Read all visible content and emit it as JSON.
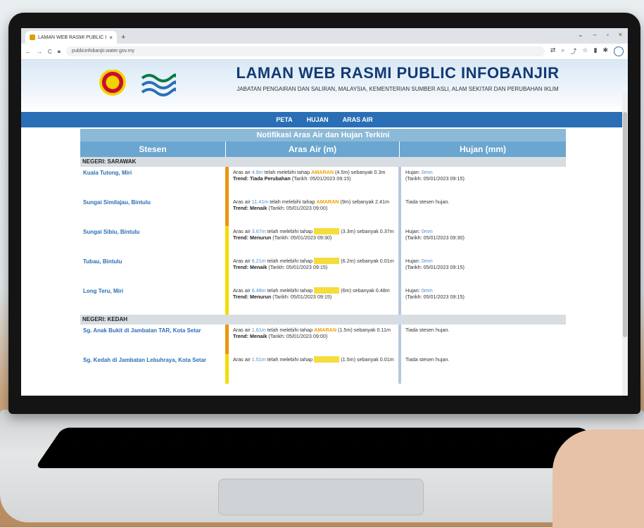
{
  "browser": {
    "tab_title": "LAMAN WEB RASMI PUBLIC INF",
    "tab_close": "×",
    "new_tab": "+",
    "url": "publicinfobanjir.water.gov.my",
    "nav_back": "←",
    "nav_forward": "→",
    "reload": "C"
  },
  "site": {
    "title": "LAMAN WEB RASMI PUBLIC INFOBANJIR",
    "subtitle": "JABATAN PENGAIRAN DAN SALIRAN, MALAYSIA, KEMENTERIAN SUMBER ASLI, ALAM SEKITAR DAN PERUBAHAN IKLIM"
  },
  "nav": [
    "PETA",
    "HUJAN",
    "ARAS AIR"
  ],
  "panel": {
    "heading": "Notifikasi Aras Air dan Hujan Terkini",
    "columns": [
      "Stesen",
      "Aras Air (m)",
      "Hujan (mm)"
    ]
  },
  "states": [
    {
      "name": "NEGERI: SARAWAK",
      "rows": [
        {
          "station": "Kuala Tutong, Miri",
          "level_prefix": "Aras air ",
          "level_value": "4.8m",
          "level_mid": " telah melebihi tahap ",
          "status": "AMARAN",
          "threshold": " (4.5m) sebanyak 0.3m",
          "trend_label": "Trend: Tiada Perubahan",
          "trend_date": " (Tarikh: 05/01/2023 09:15)",
          "rain_prefix": "Hujan: ",
          "rain_value": "0mm",
          "rain_date": "(Tarikh: 05/01/2023 09:15)",
          "alert": false,
          "has_rain": true
        },
        {
          "station": "Sungai Similajau, Bintulu",
          "level_prefix": "Aras air ",
          "level_value": "11.41m",
          "level_mid": " telah melebihi tahap ",
          "status": "AMARAN",
          "threshold": " (9m) sebanyak 2.41m",
          "trend_label": "Trend: Menaik",
          "trend_date": " (Tarikh: 05/01/2023 09:00)",
          "rain_text": "Tiada stesen hujan.",
          "alert": false,
          "has_rain": false
        },
        {
          "station": "Sungai Sibiu, Bintulu",
          "level_prefix": "Aras air ",
          "level_value": "3.67m",
          "level_mid": " telah melebihi tahap ",
          "status": "WASPADA",
          "threshold": " (3.3m) sebanyak 0.37m",
          "trend_label": "Trend: Menurun",
          "trend_date": " (Tarikh: 05/01/2023 09:30)",
          "rain_prefix": "Hujan: ",
          "rain_value": "0mm",
          "rain_date": "(Tarikh: 05/01/2023 09:30)",
          "alert": true,
          "has_rain": true
        },
        {
          "station": "Tubau, Bintulu",
          "level_prefix": "Aras air ",
          "level_value": "6.21m",
          "level_mid": " telah melebihi tahap ",
          "status": "WASPADA",
          "threshold": " (6.2m) sebanyak 0.01m",
          "trend_label": "Trend: Menaik",
          "trend_date": " (Tarikh: 05/01/2023 09:15)",
          "rain_prefix": "Hujan: ",
          "rain_value": "0mm",
          "rain_date": "(Tarikh: 05/01/2023 09:15)",
          "alert": true,
          "has_rain": true
        },
        {
          "station": "Long Teru, Miri",
          "level_prefix": "Aras air ",
          "level_value": "6.48m",
          "level_mid": " telah melebihi tahap ",
          "status": "WASPADA",
          "threshold": " (6m) sebanyak 0.48m",
          "trend_label": "Trend: Menurun",
          "trend_date": " (Tarikh: 05/01/2023 09:15)",
          "rain_prefix": "Hujan: ",
          "rain_value": "0mm",
          "rain_date": "(Tarikh: 05/01/2023 09:15)",
          "alert": true,
          "has_rain": true
        }
      ]
    },
    {
      "name": "NEGERI: KEDAH",
      "rows": [
        {
          "station": "Sg. Anak Bukit di Jambatan TAR, Kota Setar",
          "level_prefix": "Aras air ",
          "level_value": "1.61m",
          "level_mid": " telah melebihi tahap ",
          "status": "AMARAN",
          "threshold": " (1.5m) sebanyak 0.11m",
          "trend_label": "Trend: Menaik",
          "trend_date": " (Tarikh: 05/01/2023 09:00)",
          "rain_text": "Tiada stesen hujan.",
          "alert": false,
          "has_rain": false
        },
        {
          "station": "Sg. Kedah di Jambatan Lebuhraya, Kota Setar",
          "level_prefix": "Aras air ",
          "level_value": "1.51m",
          "level_mid": " telah melebihi tahap ",
          "status": "WASPADA",
          "threshold": " (1.5m) sebanyak 0.01m",
          "trend_label": "",
          "trend_date": "",
          "rain_text": "Tiada stesen hujan.",
          "alert": true,
          "has_rain": false
        }
      ]
    }
  ]
}
